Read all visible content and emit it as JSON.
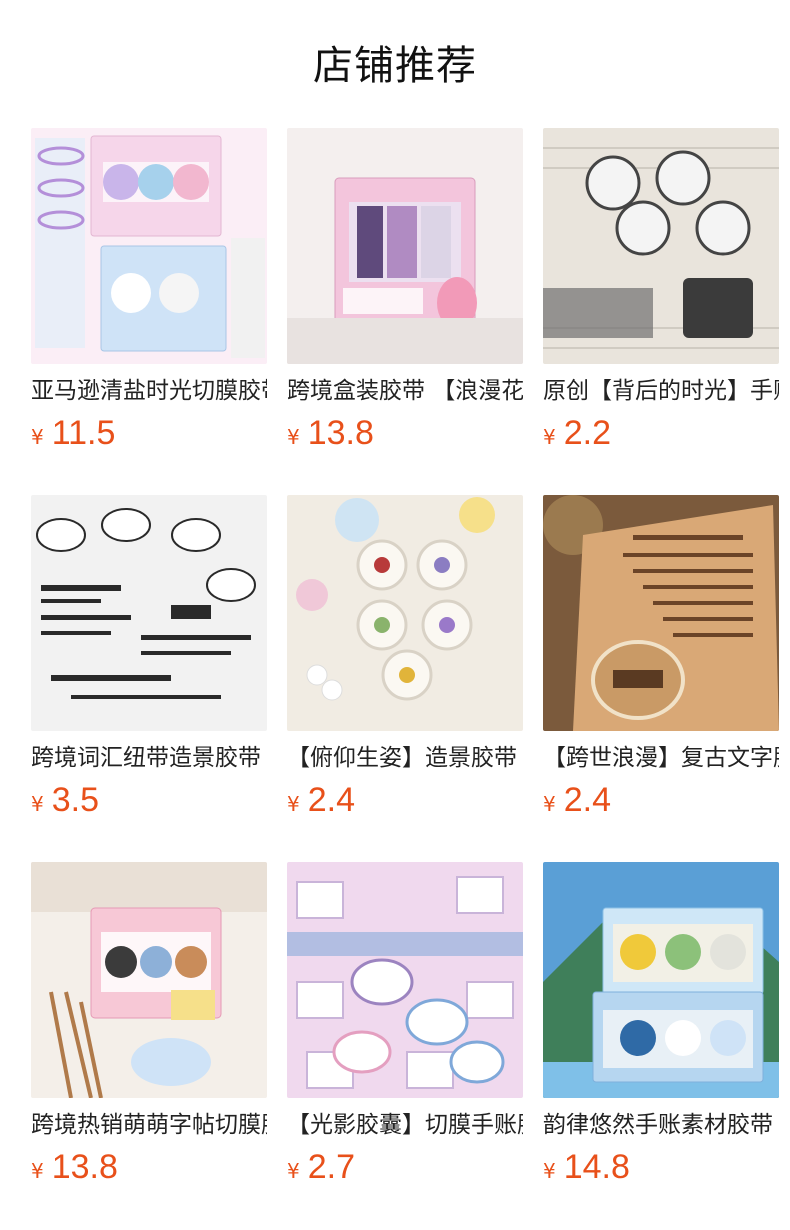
{
  "header": {
    "title": "店铺推荐"
  },
  "currency_symbol": "¥",
  "products": [
    {
      "name": "亚马逊清盐时光切膜胶带",
      "price": "11.5",
      "image": "salt-sea-song-tape-box-photo",
      "colors": [
        "#f6d6ea",
        "#cfe3f7"
      ]
    },
    {
      "name": "跨境盒装胶带 【浪漫花语】",
      "price": "13.8",
      "image": "romantic-flower-tape-box-photo",
      "colors": [
        "#f3c5dc",
        "#8e6ea8"
      ]
    },
    {
      "name": "原创【背后的时光】手账胶带",
      "price": "2.2",
      "image": "vintage-text-tape-rolls-photo",
      "colors": [
        "#e9e4dc",
        "#3b3b3b"
      ]
    },
    {
      "name": "跨境词汇纽带造景胶带",
      "price": "3.5",
      "image": "word-ribbon-tape-rolls-photo",
      "colors": [
        "#f2f2f2",
        "#2a2a2a"
      ]
    },
    {
      "name": "【俯仰生姿】造景胶带",
      "price": "2.4",
      "image": "floral-tape-rolls-photo",
      "colors": [
        "#f1ece3",
        "#8ab36c"
      ]
    },
    {
      "name": "【跨世浪漫】复古文字胶带",
      "price": "2.4",
      "image": "kraft-poem-tape-photo",
      "colors": [
        "#d9a876",
        "#6b4428"
      ]
    },
    {
      "name": "跨境热销萌萌字帖切膜胶带",
      "price": "13.8",
      "image": "cute-calligraphy-tape-box-photo",
      "colors": [
        "#f7c8d6",
        "#8db0d8"
      ]
    },
    {
      "name": "【光影胶囊】切膜手账胶带",
      "price": "2.7",
      "image": "film-capsule-tape-photo",
      "colors": [
        "#f0d9ee",
        "#7fa8d9"
      ]
    },
    {
      "name": "韵律悠然手账素材胶带",
      "price": "14.8",
      "image": "landscape-tape-box-photo",
      "colors": [
        "#5a9fd6",
        "#f0c93a"
      ]
    }
  ]
}
